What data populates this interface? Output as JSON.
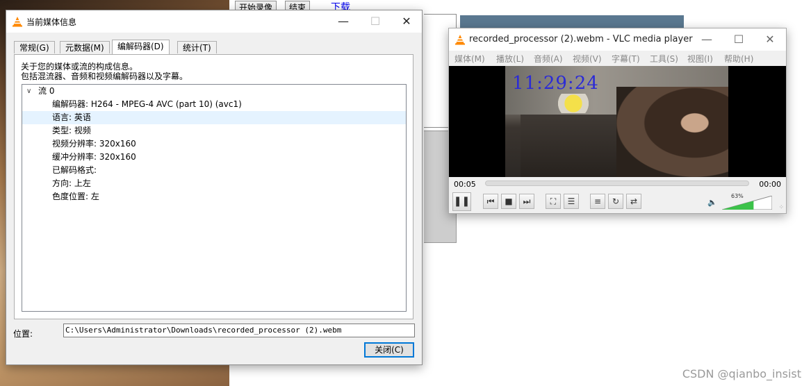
{
  "background_page": {
    "buttons": [
      "开始录像",
      "结束"
    ],
    "link": "下载"
  },
  "media_info": {
    "title": "当前媒体信息",
    "tabs": [
      {
        "label": "常规(G)",
        "active": false
      },
      {
        "label": "元数据(M)",
        "active": false
      },
      {
        "label": "编解码器(D)",
        "active": true
      },
      {
        "label": "统计(T)",
        "active": false
      }
    ],
    "description_line1": "关于您的媒体或流的构成信息。",
    "description_line2": "包括混流器、音频和视频编解码器以及字幕。",
    "tree": {
      "root": "流 0",
      "items": [
        "编解码器: H264 - MPEG-4 AVC (part 10) (avc1)",
        "语言: 英语",
        "类型: 视频",
        "视频分辨率: 320x160",
        "缓冲分辨率: 320x160",
        "已解码格式:",
        "方向: 上左",
        "色度位置: 左"
      ],
      "selected_index": 1
    },
    "location_label": "位置:",
    "location_value": "C:\\Users\\Administrator\\Downloads\\recorded_processor (2).webm",
    "close_button": "关闭(C)"
  },
  "vlc": {
    "title": "recorded_processor (2).webm - VLC media player",
    "menus": [
      "媒体(M)",
      "播放(L)",
      "音频(A)",
      "视频(V)",
      "字幕(T)",
      "工具(S)",
      "视图(I)",
      "帮助(H)"
    ],
    "video_timestamp": "11:29:24",
    "time_current": "00:05",
    "time_total": "00:00",
    "volume": "63%",
    "volume_level": 0.63
  },
  "watermark": "CSDN @qianbo_insist",
  "colors": {
    "accent": "#0078d7",
    "selection": "#e5f3ff",
    "volume_fill": "#3cc24a",
    "video_time_text": "#2b2bd6"
  }
}
